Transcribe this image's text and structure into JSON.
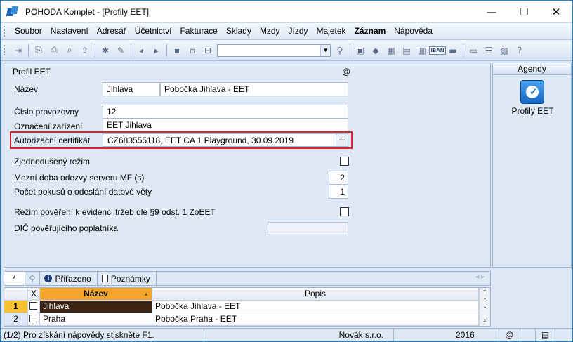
{
  "window": {
    "title": "POHODA Komplet - [Profily EET]",
    "minimize": "—",
    "maximize": "☐",
    "close": "✕"
  },
  "menu": [
    "Soubor",
    "Nastavení",
    "Adresář",
    "Účetnictví",
    "Fakturace",
    "Sklady",
    "Mzdy",
    "Jízdy",
    "Majetek",
    "Záznam",
    "Nápověda"
  ],
  "form": {
    "header": "Profil EET",
    "at_symbol": "@",
    "nazev_label": "Název",
    "nazev_code": "Jihlava",
    "nazev_name": "Pobočka Jihlava - EET",
    "provozovna_label": "Číslo provozovny",
    "provozovna_value": "12",
    "zarizeni_label": "Označení zařízení",
    "zarizeni_value": "EET Jihlava",
    "cert_label": "Autorizační certifikát",
    "cert_value": "CZ683555118, EET CA 1 Playground, 30.09.2019",
    "cert_button": "...",
    "zjednoduseny_label": "Zjednodušený režim",
    "zjednoduseny_checked": false,
    "mezni_label": "Mezní doba odezvy serveru MF (s)",
    "mezni_value": "2",
    "pokusu_label": "Počet pokusů o odeslání datové věty",
    "pokusu_value": "1",
    "rezim_label": "Režim pověření k evidenci tržeb dle §9 odst. 1 ZoEET",
    "rezim_checked": false,
    "dic_label": "DIČ pověřujícího poplatníka",
    "dic_value": ""
  },
  "agenda": {
    "title": "Agendy",
    "item_label": "Profily EET",
    "icon_glyph": "✓"
  },
  "tabs": {
    "star": "*",
    "filter_icon": "filter-icon",
    "prirazeno": "Přiřazeno",
    "poznamky": "Poznámky"
  },
  "grid": {
    "columns": [
      "X",
      "Název",
      "Popis"
    ],
    "rows": [
      {
        "num": "1",
        "nazev": "Jihlava",
        "popis": "Pobočka Jihlava - EET",
        "selected": true
      },
      {
        "num": "2",
        "nazev": "Praha",
        "popis": "Pobočka Praha - EET",
        "selected": false
      }
    ]
  },
  "status": {
    "help": "(1/2) Pro získání nápovědy stiskněte F1.",
    "company": "Novák s.r.o.",
    "year": "2016",
    "at": "@"
  }
}
